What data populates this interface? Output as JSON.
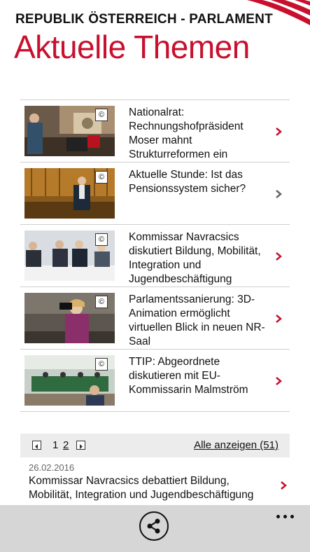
{
  "header": {
    "supertitle": "REPUBLIK ÖSTERREICH - PARLAMENT",
    "title": "Aktuelle Themen",
    "accent_color": "#c8102e"
  },
  "news": [
    {
      "title": "Nationalrat: Rechnungshofpräsident Moser mahnt Strukturreformen ein",
      "badge": "©",
      "chevron_color": "#c8102e"
    },
    {
      "title": "Aktuelle Stunde: Ist das Pensionssystem sicher?",
      "badge": "©",
      "chevron_color": "#666666"
    },
    {
      "title": "Kommissar Navracsics diskutiert Bildung, Mobilität, Integration und Jugendbeschäftigung",
      "badge": "©",
      "chevron_color": "#c8102e"
    },
    {
      "title": "Parlamentssanierung: 3D-Animation ermöglicht virtuellen Blick in neuen NR-Saal",
      "badge": "©",
      "chevron_color": "#c8102e"
    },
    {
      "title": "TTIP: Abgeordnete diskutieren mit EU-Kommissarin Malmström",
      "badge": "©",
      "chevron_color": "#c8102e"
    }
  ],
  "pager": {
    "pages": [
      "1",
      "2"
    ],
    "current_page": "2",
    "show_all_label": "Alle anzeigen (51)"
  },
  "latest": {
    "date": "26.02.2016",
    "title": "Kommissar Navracsics debattiert Bildung, Mobilität, Integration und Jugendbeschäftigung"
  },
  "appbar": {
    "share_icon": "share-icon",
    "more_icon": "more-icon"
  }
}
